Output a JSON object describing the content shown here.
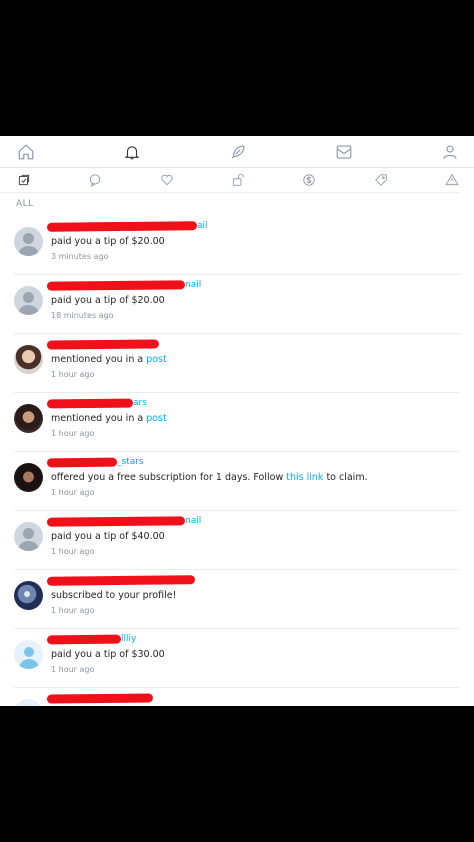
{
  "nav": {
    "icons": [
      "home-icon",
      "bell-icon",
      "feather-icon",
      "dollar-icon",
      "message-icon",
      "user-icon"
    ]
  },
  "filters": {
    "icons": [
      "all-check-icon",
      "comment-icon",
      "heart-icon",
      "unlock-icon",
      "tip-dollar-icon",
      "promo-tag-icon",
      "warning-icon"
    ],
    "label": "ALL"
  },
  "notifications": [
    {
      "avatar": "default",
      "handle_suffix": "ail",
      "message": "paid you a tip of $20.00",
      "time": "3 minutes ago"
    },
    {
      "avatar": "default",
      "handle_suffix": "nail",
      "message": "paid you a tip of $20.00",
      "time": "18 minutes ago"
    },
    {
      "avatar": "photo-a",
      "handle_suffix": "",
      "message_prefix": "mentioned you in a ",
      "link": "post",
      "time": "1 hour ago"
    },
    {
      "avatar": "photo-b",
      "handle_suffix": "ars",
      "message_prefix": "mentioned you in a ",
      "link": "post",
      "time": "1 hour ago"
    },
    {
      "avatar": "photo-c",
      "handle_suffix": "_stars",
      "message_prefix": "offered you a free subscription for 1 days. Follow ",
      "link": "this link",
      "message_suffix": " to claim.",
      "time": "1 hour ago"
    },
    {
      "avatar": "default",
      "handle_suffix": "nail",
      "message": "paid you a tip of $40.00",
      "time": "1 hour ago"
    },
    {
      "avatar": "photo-d",
      "handle_suffix": "",
      "message": "subscribed to your profile!",
      "time": "1 hour ago"
    },
    {
      "avatar": "light",
      "handle_suffix": "llliy",
      "message": "paid you a tip of $30.00",
      "time": "1 hour ago"
    }
  ],
  "colors": {
    "accent": "#00aff0",
    "redaction": "#f0101a",
    "muted": "#8a96a3"
  }
}
